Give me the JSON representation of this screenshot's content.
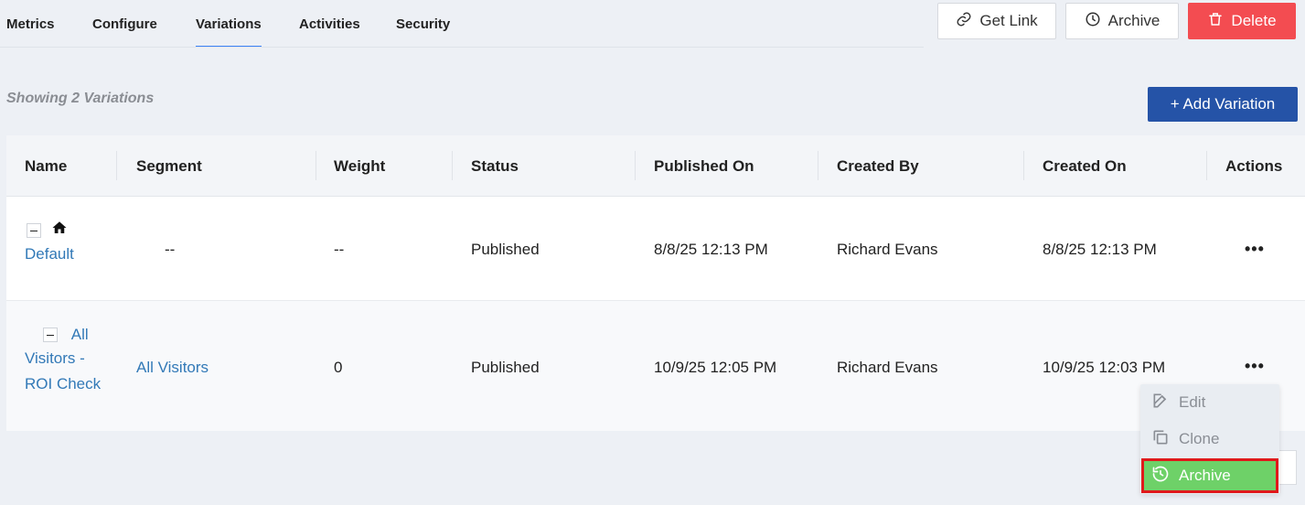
{
  "tabs": [
    {
      "label": "Metrics"
    },
    {
      "label": "Configure"
    },
    {
      "label": "Variations"
    },
    {
      "label": "Activities"
    },
    {
      "label": "Security"
    }
  ],
  "actions": {
    "get_link": "Get Link",
    "archive": "Archive",
    "delete": "Delete"
  },
  "showing_text": "Showing 2 Variations",
  "add_variation": "+ Add Variation",
  "table": {
    "headers": [
      "Name",
      "Segment",
      "Weight",
      "Status",
      "Published On",
      "Created By",
      "Created On",
      "Actions"
    ],
    "rows": [
      {
        "name": "Default",
        "segment": "--",
        "weight": "--",
        "status": "Published",
        "published_on": "8/8/25 12:13 PM",
        "created_by": "Richard Evans",
        "created_on": "8/8/25 12:13 PM",
        "actions": "•••"
      },
      {
        "name_line1": "All",
        "name_line2": "Visitors -",
        "name_line3": "ROI Check",
        "segment": "All Visitors",
        "weight": "0",
        "status": "Published",
        "published_on": "10/9/25 12:05 PM",
        "created_by": "Richard Evans",
        "created_on": "10/9/25 12:03 PM",
        "actions": "•••"
      }
    ]
  },
  "menu": {
    "edit": "Edit",
    "clone": "Clone",
    "archive": "Archive"
  },
  "colors": {
    "accent": "#3b82f6",
    "primary": "#2553a7",
    "danger": "#f34c51",
    "link": "#3279b7",
    "highlight": "#6ed168",
    "highlight_border": "#e0191b"
  }
}
